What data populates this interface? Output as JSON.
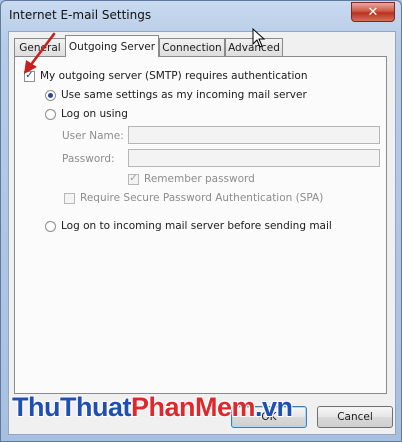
{
  "window": {
    "title": "Internet E-mail Settings",
    "close_glyph": "✕"
  },
  "tabs": [
    {
      "label": "General",
      "active": false
    },
    {
      "label": "Outgoing Server",
      "active": true
    },
    {
      "label": "Connection",
      "active": false
    },
    {
      "label": "Advanced",
      "active": false
    }
  ],
  "smtp_auth": {
    "label": "My outgoing server (SMTP) requires authentication",
    "checked": true
  },
  "options": {
    "use_same_label": "Use same settings as my incoming mail server",
    "log_on_using_label": "Log on using",
    "user_name_label": "User Name:",
    "user_name_value": "",
    "password_label": "Password:",
    "password_value": "",
    "remember_password_label": "Remember password",
    "remember_password_checked": true,
    "spa_label": "Require Secure Password Authentication (SPA)",
    "spa_checked": false,
    "log_on_incoming_label": "Log on to incoming mail server before sending mail",
    "selected": "use_same"
  },
  "buttons": {
    "ok": "OK",
    "cancel": "Cancel"
  },
  "watermark": {
    "part1": "ThuThuat",
    "part2": "PhanMem",
    "part3": ".vn",
    "color1": "#1f4fb5",
    "color2": "#e0272c",
    "color3": "#1f4fb5"
  },
  "icons": {
    "check": "✓",
    "annotation": "red-arrow-icon",
    "pointer": "cursor-icon"
  },
  "colors": {
    "annotation_arrow": "#c8201f"
  }
}
